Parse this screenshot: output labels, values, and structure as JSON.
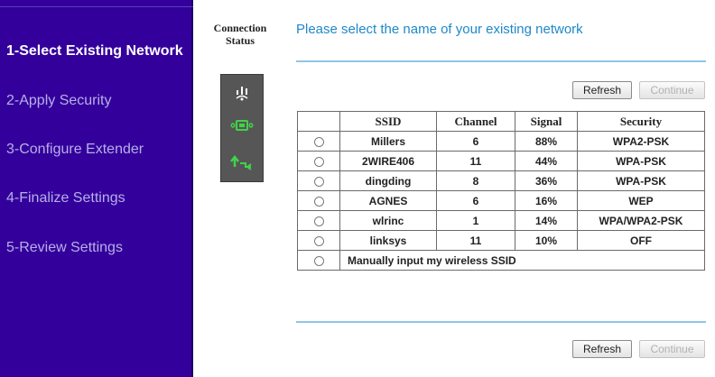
{
  "sidebar": {
    "steps": [
      {
        "label": "1-Select Existing Network"
      },
      {
        "label": "2-Apply Security"
      },
      {
        "label": "3-Configure Extender"
      },
      {
        "label": "4-Finalize Settings"
      },
      {
        "label": "5-Review Settings"
      }
    ]
  },
  "status": {
    "label_line1": "Connection",
    "label_line2": "Status",
    "icons": [
      "signal-bars-icon",
      "router-icon",
      "extender-link-icon"
    ]
  },
  "main": {
    "headline": "Please select the name of your existing network",
    "refresh_label": "Refresh",
    "continue_label": "Continue"
  },
  "table": {
    "headers": [
      "",
      "SSID",
      "Channel",
      "Signal",
      "Security"
    ],
    "rows": [
      {
        "ssid": "Millers",
        "channel": "6",
        "signal": "88%",
        "security": "WPA2-PSK"
      },
      {
        "ssid": "2WIRE406",
        "channel": "11",
        "signal": "44%",
        "security": "WPA-PSK"
      },
      {
        "ssid": "dingding",
        "channel": "8",
        "signal": "36%",
        "security": "WPA-PSK"
      },
      {
        "ssid": "AGNES",
        "channel": "6",
        "signal": "16%",
        "security": "WEP"
      },
      {
        "ssid": "wlrinc",
        "channel": "1",
        "signal": "14%",
        "security": "WPA/WPA2-PSK"
      },
      {
        "ssid": "linksys",
        "channel": "11",
        "signal": "10%",
        "security": "OFF"
      }
    ],
    "manual_label": "Manually input my wireless SSID"
  },
  "colors": {
    "sidebar_bg": "#34009c",
    "headline": "#1f88c9",
    "rule": "#8fc6e6",
    "status_panel": "#565656"
  }
}
